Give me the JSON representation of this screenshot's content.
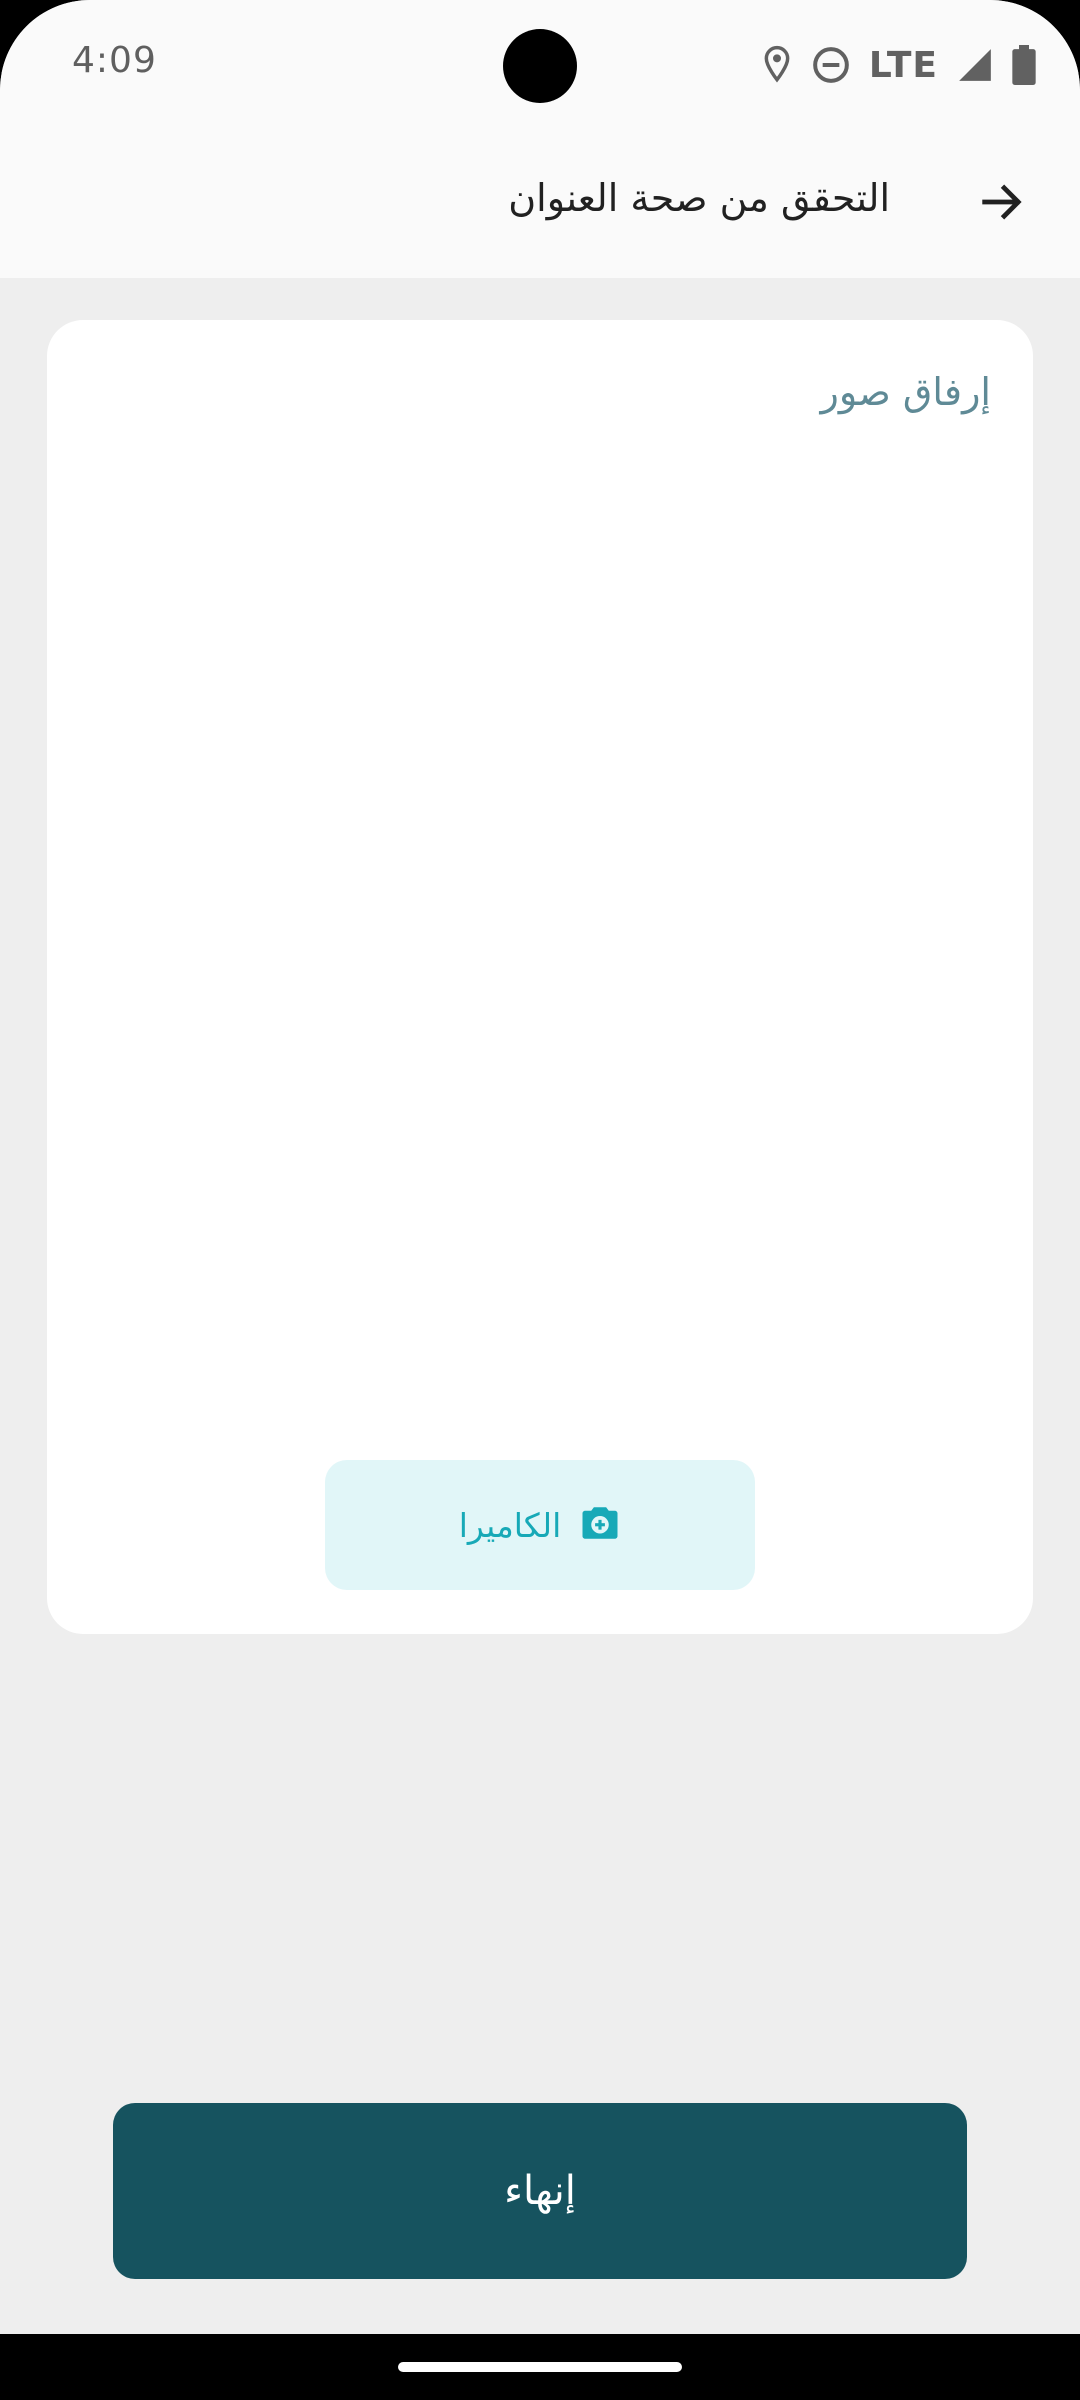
{
  "status_bar": {
    "time": "4:09",
    "network": "LTE",
    "icons": [
      "location-icon",
      "do-not-disturb-icon",
      "signal-icon",
      "battery-icon"
    ]
  },
  "app_bar": {
    "title": "التحقق من صحة العنوان",
    "back_icon": "arrow-right-icon"
  },
  "card": {
    "title": "إرفاق صور",
    "camera_button": {
      "label": "الكاميرا",
      "icon": "camera-add-icon"
    }
  },
  "finish_button": {
    "label": "إنهاء"
  },
  "colors": {
    "background": "#eeeeee",
    "surface": "#ffffff",
    "bar": "#fafafa",
    "accent": "#17a9b7",
    "accent_light": "#e1f6f8",
    "primary": "#16535f",
    "card_title": "#5f8a96"
  }
}
